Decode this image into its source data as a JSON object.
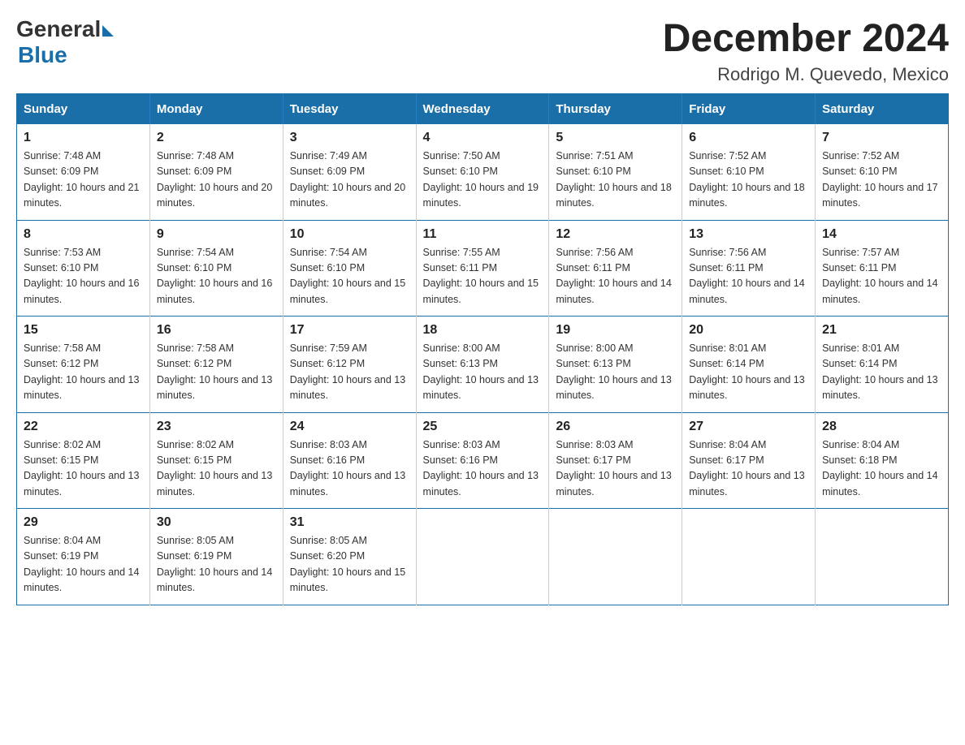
{
  "logo": {
    "general": "General",
    "blue": "Blue"
  },
  "title": "December 2024",
  "subtitle": "Rodrigo M. Quevedo, Mexico",
  "weekdays": [
    "Sunday",
    "Monday",
    "Tuesday",
    "Wednesday",
    "Thursday",
    "Friday",
    "Saturday"
  ],
  "weeks": [
    [
      {
        "day": "1",
        "sunrise": "7:48 AM",
        "sunset": "6:09 PM",
        "daylight": "10 hours and 21 minutes."
      },
      {
        "day": "2",
        "sunrise": "7:48 AM",
        "sunset": "6:09 PM",
        "daylight": "10 hours and 20 minutes."
      },
      {
        "day": "3",
        "sunrise": "7:49 AM",
        "sunset": "6:09 PM",
        "daylight": "10 hours and 20 minutes."
      },
      {
        "day": "4",
        "sunrise": "7:50 AM",
        "sunset": "6:10 PM",
        "daylight": "10 hours and 19 minutes."
      },
      {
        "day": "5",
        "sunrise": "7:51 AM",
        "sunset": "6:10 PM",
        "daylight": "10 hours and 18 minutes."
      },
      {
        "day": "6",
        "sunrise": "7:52 AM",
        "sunset": "6:10 PM",
        "daylight": "10 hours and 18 minutes."
      },
      {
        "day": "7",
        "sunrise": "7:52 AM",
        "sunset": "6:10 PM",
        "daylight": "10 hours and 17 minutes."
      }
    ],
    [
      {
        "day": "8",
        "sunrise": "7:53 AM",
        "sunset": "6:10 PM",
        "daylight": "10 hours and 16 minutes."
      },
      {
        "day": "9",
        "sunrise": "7:54 AM",
        "sunset": "6:10 PM",
        "daylight": "10 hours and 16 minutes."
      },
      {
        "day": "10",
        "sunrise": "7:54 AM",
        "sunset": "6:10 PM",
        "daylight": "10 hours and 15 minutes."
      },
      {
        "day": "11",
        "sunrise": "7:55 AM",
        "sunset": "6:11 PM",
        "daylight": "10 hours and 15 minutes."
      },
      {
        "day": "12",
        "sunrise": "7:56 AM",
        "sunset": "6:11 PM",
        "daylight": "10 hours and 14 minutes."
      },
      {
        "day": "13",
        "sunrise": "7:56 AM",
        "sunset": "6:11 PM",
        "daylight": "10 hours and 14 minutes."
      },
      {
        "day": "14",
        "sunrise": "7:57 AM",
        "sunset": "6:11 PM",
        "daylight": "10 hours and 14 minutes."
      }
    ],
    [
      {
        "day": "15",
        "sunrise": "7:58 AM",
        "sunset": "6:12 PM",
        "daylight": "10 hours and 13 minutes."
      },
      {
        "day": "16",
        "sunrise": "7:58 AM",
        "sunset": "6:12 PM",
        "daylight": "10 hours and 13 minutes."
      },
      {
        "day": "17",
        "sunrise": "7:59 AM",
        "sunset": "6:12 PM",
        "daylight": "10 hours and 13 minutes."
      },
      {
        "day": "18",
        "sunrise": "8:00 AM",
        "sunset": "6:13 PM",
        "daylight": "10 hours and 13 minutes."
      },
      {
        "day": "19",
        "sunrise": "8:00 AM",
        "sunset": "6:13 PM",
        "daylight": "10 hours and 13 minutes."
      },
      {
        "day": "20",
        "sunrise": "8:01 AM",
        "sunset": "6:14 PM",
        "daylight": "10 hours and 13 minutes."
      },
      {
        "day": "21",
        "sunrise": "8:01 AM",
        "sunset": "6:14 PM",
        "daylight": "10 hours and 13 minutes."
      }
    ],
    [
      {
        "day": "22",
        "sunrise": "8:02 AM",
        "sunset": "6:15 PM",
        "daylight": "10 hours and 13 minutes."
      },
      {
        "day": "23",
        "sunrise": "8:02 AM",
        "sunset": "6:15 PM",
        "daylight": "10 hours and 13 minutes."
      },
      {
        "day": "24",
        "sunrise": "8:03 AM",
        "sunset": "6:16 PM",
        "daylight": "10 hours and 13 minutes."
      },
      {
        "day": "25",
        "sunrise": "8:03 AM",
        "sunset": "6:16 PM",
        "daylight": "10 hours and 13 minutes."
      },
      {
        "day": "26",
        "sunrise": "8:03 AM",
        "sunset": "6:17 PM",
        "daylight": "10 hours and 13 minutes."
      },
      {
        "day": "27",
        "sunrise": "8:04 AM",
        "sunset": "6:17 PM",
        "daylight": "10 hours and 13 minutes."
      },
      {
        "day": "28",
        "sunrise": "8:04 AM",
        "sunset": "6:18 PM",
        "daylight": "10 hours and 14 minutes."
      }
    ],
    [
      {
        "day": "29",
        "sunrise": "8:04 AM",
        "sunset": "6:19 PM",
        "daylight": "10 hours and 14 minutes."
      },
      {
        "day": "30",
        "sunrise": "8:05 AM",
        "sunset": "6:19 PM",
        "daylight": "10 hours and 14 minutes."
      },
      {
        "day": "31",
        "sunrise": "8:05 AM",
        "sunset": "6:20 PM",
        "daylight": "10 hours and 15 minutes."
      },
      null,
      null,
      null,
      null
    ]
  ],
  "labels": {
    "sunrise": "Sunrise:",
    "sunset": "Sunset:",
    "daylight": "Daylight:"
  }
}
